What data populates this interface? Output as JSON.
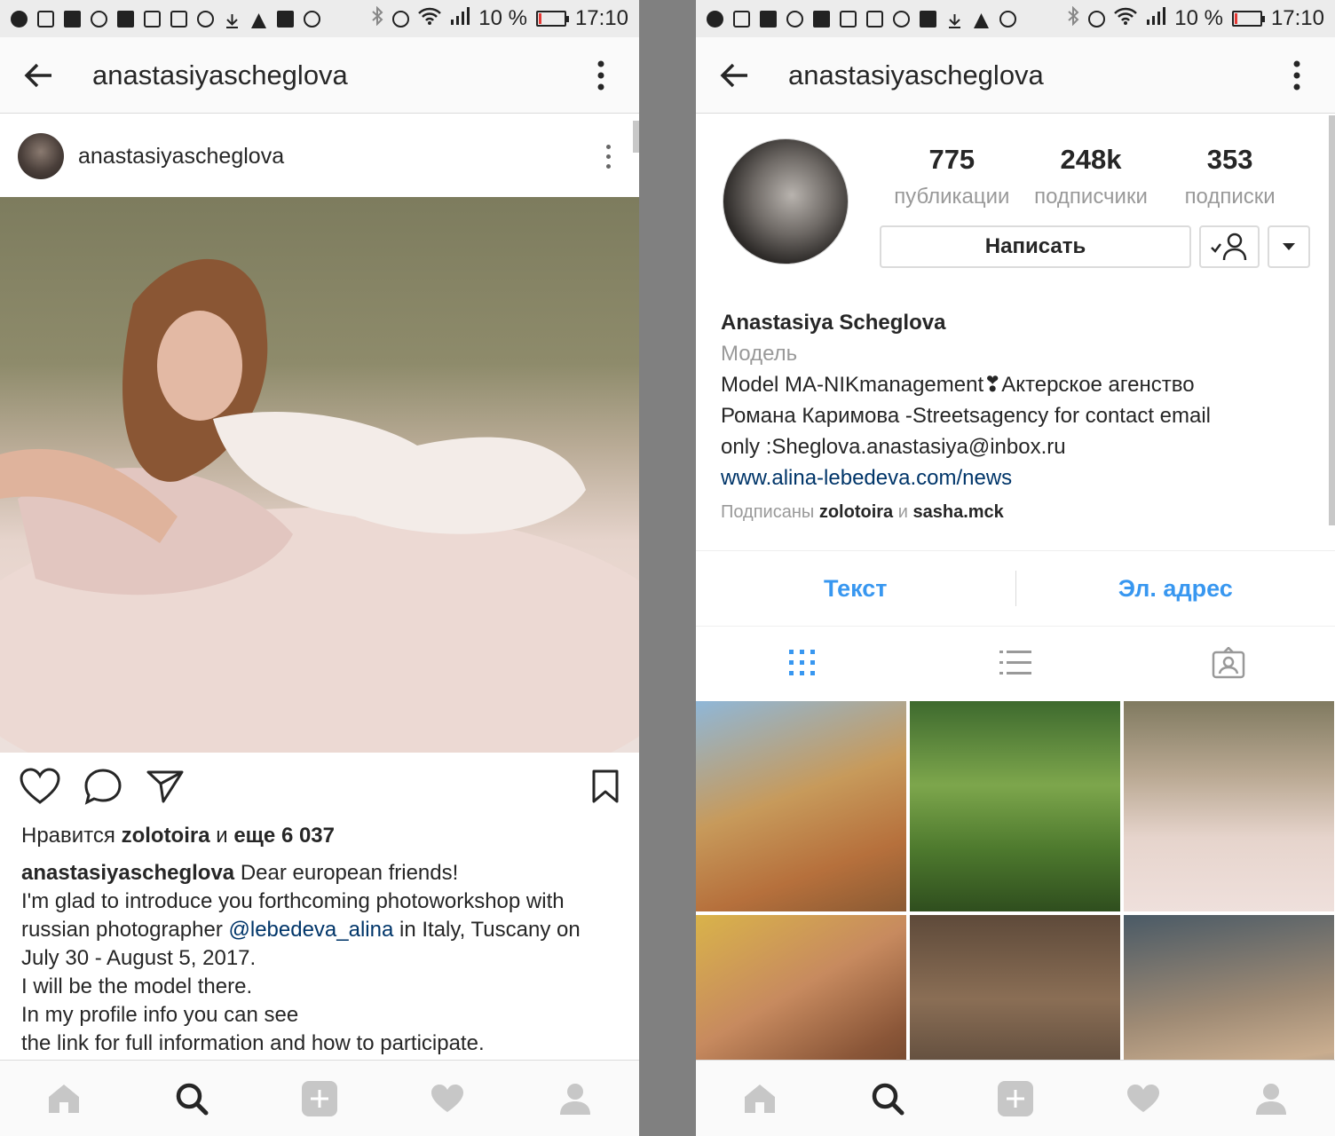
{
  "status_bar": {
    "battery": "10 %",
    "battery_level": 0.1,
    "time": "17:10"
  },
  "left_screen": {
    "header_title": "anastasiyascheglova",
    "post": {
      "username": "anastasiyascheglova",
      "likes_prefix": "Нравится",
      "likes_user": "zolotoira",
      "likes_and": "и",
      "likes_more": "еще 6 037",
      "caption_user": "anastasiyascheglova",
      "caption_line1": "Dear european friends!",
      "caption_line2": "I'm glad to introduce you forthcoming photoworkshop with",
      "caption_line3_pre": "russian photographer",
      "caption_mention": "@lebedeva_alina",
      "caption_line3_post": "in Italy, Tuscany on",
      "caption_line4": "July 30 - August 5, 2017.",
      "caption_line5": "I will be the model there.",
      "caption_line6": "In my profile info you can see",
      "caption_line7": "the link for full information and how to participate."
    }
  },
  "right_screen": {
    "header_title": "anastasiyascheglova",
    "stats": [
      {
        "value": "775",
        "label": "публикации"
      },
      {
        "value": "248k",
        "label": "подписчики"
      },
      {
        "value": "353",
        "label": "подписки"
      }
    ],
    "message_button": "Написать",
    "bio": {
      "name": "Anastasiya Scheglova",
      "category": "Модель",
      "line1": "Model MA-NIKmanagement❣Актерское агенство",
      "line2": "Романа Каримова -Streetsagency for contact email",
      "line3": "only :Sheglova.anastasiya@inbox.ru",
      "link": "www.alina-lebedeva.com/news",
      "followed_prefix": "Подписаны",
      "followed_user1": "zolotoira",
      "followed_and": "и",
      "followed_user2": "sasha.mck"
    },
    "contact_buttons": [
      "Текст",
      "Эл. адрес"
    ]
  },
  "colors": {
    "accent_blue": "#3897f0",
    "link_blue": "#003569",
    "muted": "#999999"
  }
}
